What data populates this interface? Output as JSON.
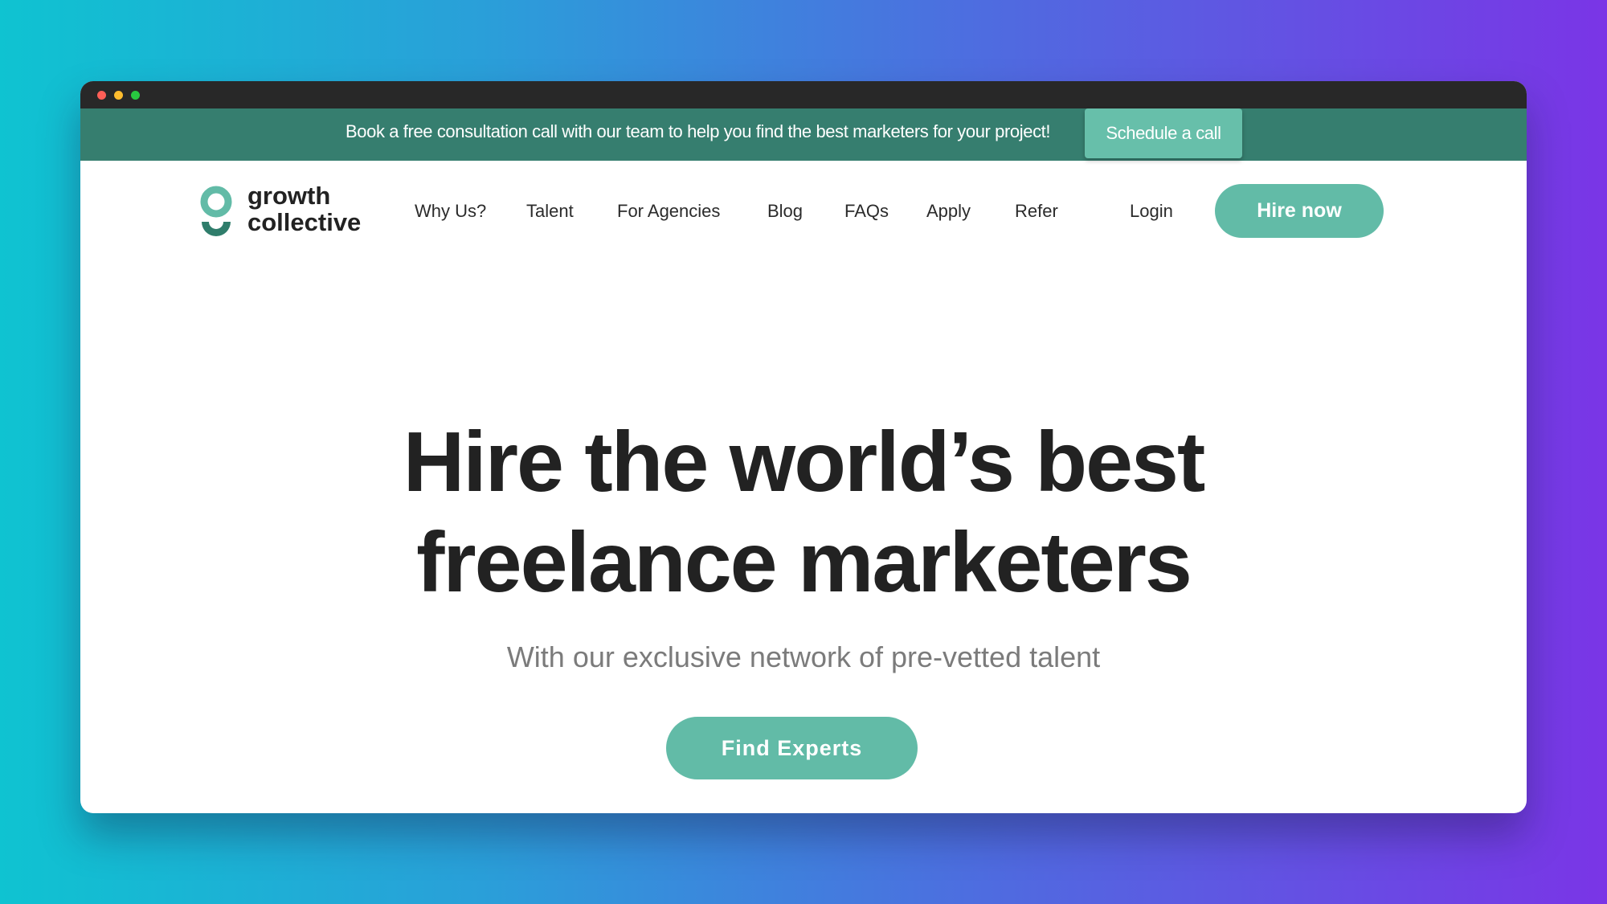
{
  "banner": {
    "text": "Book a free consultation call with our team to help you find the best marketers for your project!",
    "button_label": "Schedule a call"
  },
  "logo": {
    "line1": "growth",
    "line2": "collective"
  },
  "nav": {
    "items": [
      "Why Us?",
      "Talent",
      "For Agencies",
      "Blog",
      "FAQs",
      "Apply",
      "Refer"
    ],
    "login": "Login",
    "cta": "Hire now"
  },
  "hero": {
    "title_line1": "Hire the world’s best",
    "title_line2": "freelance marketers",
    "subtitle": "With our exclusive network of pre-vetted talent",
    "button_label": "Find Experts"
  },
  "colors": {
    "banner_bg": "#367e6f",
    "accent": "#62bba7",
    "logo_light": "#62bba7",
    "logo_dark": "#2f7d6b"
  }
}
